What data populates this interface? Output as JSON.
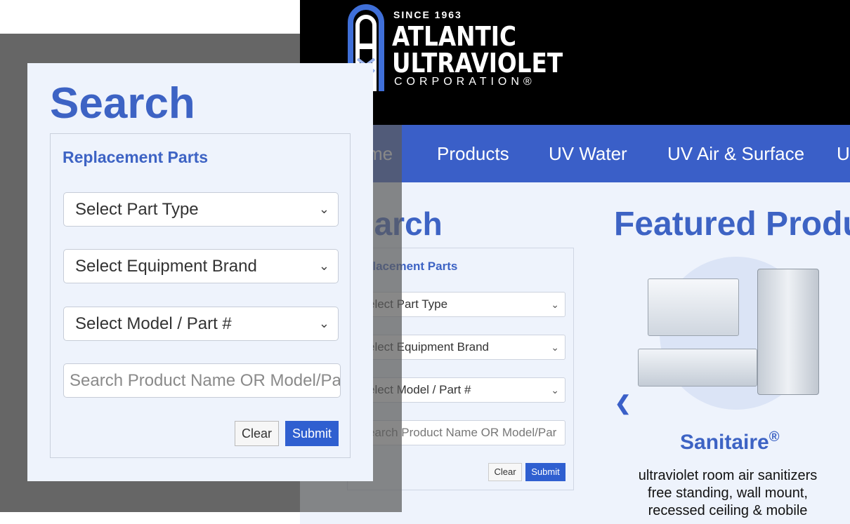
{
  "logo": {
    "since": "SINCE 1963",
    "line1": "ATLANTIC",
    "line2": "ULTRAVIOLET",
    "line3": "CORPORATION®"
  },
  "nav": {
    "items": [
      "me",
      "Products",
      "UV Water",
      "UV Air & Surface",
      "U"
    ]
  },
  "search_background": {
    "title": "earch",
    "panel_title": "placement Parts",
    "part_type": "elect Part Type",
    "brand": "elect Equipment Brand",
    "model": "elect Model / Part #",
    "search_placeholder": "earch Product Name OR Model/Par",
    "clear": "Clear",
    "submit": "Submit"
  },
  "featured": {
    "title": "Featured Product",
    "product_name": "Sanitaire",
    "trademark": "®",
    "description": [
      "ultraviolet room air sanitizers",
      "free standing, wall mount,",
      "recessed ceiling & mobile"
    ]
  },
  "zoom_search": {
    "title": "Search",
    "panel_title": "Replacement Parts",
    "part_type": "Select Part Type",
    "brand": "Select Equipment Brand",
    "model": "Select Model / Part #",
    "search_placeholder": "Search Product Name OR Model/Par",
    "clear": "Clear",
    "submit": "Submit"
  },
  "colors": {
    "brand_blue": "#3a5fc8",
    "heading_blue": "#3d63c4",
    "button_blue": "#2f5fd0",
    "panel_bg": "#eef3fc"
  },
  "icons": {
    "dropdown": "chevron-down-icon",
    "carousel_prev": "chevron-left-icon"
  }
}
